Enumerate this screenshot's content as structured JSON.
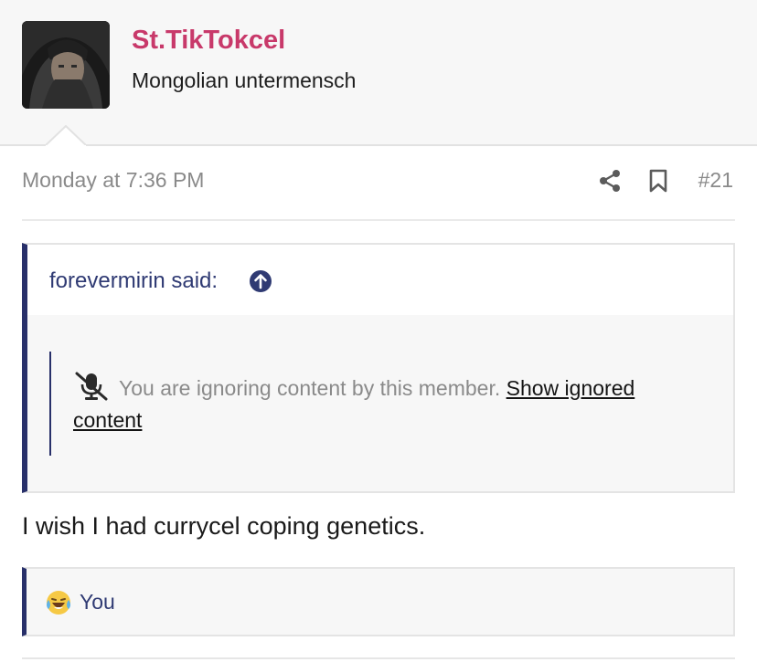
{
  "user": {
    "name": "St.TikTokcel",
    "title": "Mongolian untermensch",
    "name_color": "#c8396a"
  },
  "post": {
    "date": "Monday at 7:36 PM",
    "number": "#21",
    "body": "I wish I had currycel coping genetics."
  },
  "quote": {
    "author_said": "forevermirin said:",
    "ignored_text": "You are ignoring content by this member.",
    "show_link": "Show ignored content"
  },
  "reactions": {
    "emoji": "😂",
    "users": "You"
  },
  "icons": [
    "share-icon",
    "bookmark-icon",
    "arrow-up-circle-icon",
    "mute-microphone-icon",
    "laughing-tears-emoji-icon"
  ],
  "colors": {
    "accent": "#28306a",
    "link": "#2f3a73",
    "meta": "#8a8a8a"
  }
}
